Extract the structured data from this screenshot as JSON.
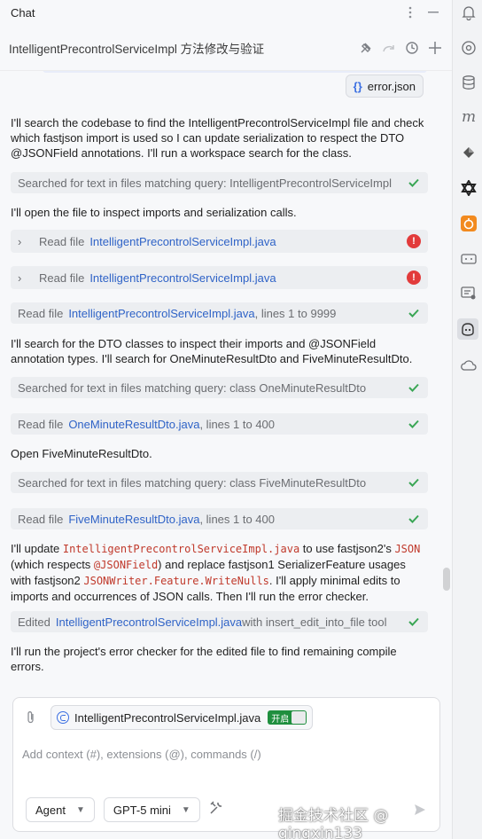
{
  "header": {
    "title": "Chat",
    "icons": [
      "more-vertical-icon",
      "minimize-icon"
    ]
  },
  "session": {
    "title": "IntelligentPrecontrolServiceImpl 方法修改与验证",
    "icons": [
      "pin-icon",
      "redo-icon",
      "history-icon",
      "new-chat-icon"
    ]
  },
  "attached_file": {
    "icon": "json-braces-icon",
    "label": "error.json"
  },
  "messages": [
    {
      "type": "text",
      "text": "I'll search the codebase to find the IntelligentPrecontrolServiceImpl file and check which fastjson import is used so I can update serialization to respect the DTO @JSONField annotations. I'll run a workspace search for the class."
    },
    {
      "type": "step",
      "prefix": "Searched for text in files matching query: IntelligentPrecontrolServiceImpl",
      "link": "",
      "suffix": "",
      "status": "ok"
    },
    {
      "type": "text",
      "text": "I'll open the file to inspect imports and serialization calls."
    },
    {
      "type": "step",
      "prefix": "Read file",
      "link": "IntelligentPrecontrolServiceImpl.java",
      "suffix": "",
      "status": "error",
      "expandable": true
    },
    {
      "type": "step",
      "prefix": "Read file",
      "link": "IntelligentPrecontrolServiceImpl.java",
      "suffix": "",
      "status": "error",
      "expandable": true
    },
    {
      "type": "step",
      "prefix": "Read file",
      "link": "IntelligentPrecontrolServiceImpl.java",
      "suffix": ", lines 1 to 9999",
      "status": "ok"
    },
    {
      "type": "text",
      "text": "I'll search for the DTO classes to inspect their imports and @JSONField annotation types. I'll search for OneMinuteResultDto and FiveMinuteResultDto."
    },
    {
      "type": "step",
      "prefix": "Searched for text in files matching query: class OneMinuteResultDto",
      "link": "",
      "suffix": "",
      "status": "ok"
    },
    {
      "type": "step",
      "prefix": "Read file",
      "link": "OneMinuteResultDto.java",
      "suffix": ", lines 1 to 400",
      "status": "ok"
    },
    {
      "type": "text",
      "text": "Open FiveMinuteResultDto."
    },
    {
      "type": "step",
      "prefix": "Searched for text in files matching query: class FiveMinuteResultDto",
      "link": "",
      "suffix": "",
      "status": "ok"
    },
    {
      "type": "step",
      "prefix": "Read file",
      "link": "FiveMinuteResultDto.java",
      "suffix": ", lines 1 to 400",
      "status": "ok"
    },
    {
      "type": "rich",
      "parts": [
        {
          "t": "I'll update "
        },
        {
          "c": "IntelligentPrecontrolServiceImpl.java"
        },
        {
          "t": " to use fastjson2's "
        },
        {
          "c": "JSON"
        },
        {
          "t": " (which respects "
        },
        {
          "c": "@JSONField"
        },
        {
          "t": ") and replace fastjson1 SerializerFeature usages with fastjson2 "
        },
        {
          "c": "JSONWriter.Feature.WriteNulls"
        },
        {
          "t": ". I'll apply minimal edits to imports and occurrences of JSON calls. Then I'll run the error checker."
        }
      ]
    },
    {
      "type": "step",
      "prefix": "Edited",
      "link": "IntelligentPrecontrolServiceImpl.java",
      "suffix": " with insert_edit_into_file tool",
      "status": "ok"
    },
    {
      "type": "text",
      "text": "I'll run the project's error checker for the edited file to find remaining compile errors."
    }
  ],
  "composer": {
    "context_file": "IntelligentPrecontrolServiceImpl.java",
    "context_toggle": "开启",
    "placeholder": "Add context (#), extensions (@), commands (/)",
    "mode": "Agent",
    "model": "GPT-5 mini"
  },
  "watermark": "掘金技术社区 @ qingxin133",
  "rightbar_icons": [
    "notifications-icon",
    "chat-at-icon",
    "database-icon",
    "m-icon",
    "plugin-icon",
    "ai-assistant-icon",
    "orange-app-icon",
    "game-controller-icon",
    "code-review-icon",
    "copilot-icon",
    "cloud-sync-icon"
  ],
  "colors": {
    "link": "#2f63c7",
    "code": "#c0392b",
    "ok": "#3aa655",
    "error": "#e23b3b",
    "toggle": "#1f8f3e"
  }
}
